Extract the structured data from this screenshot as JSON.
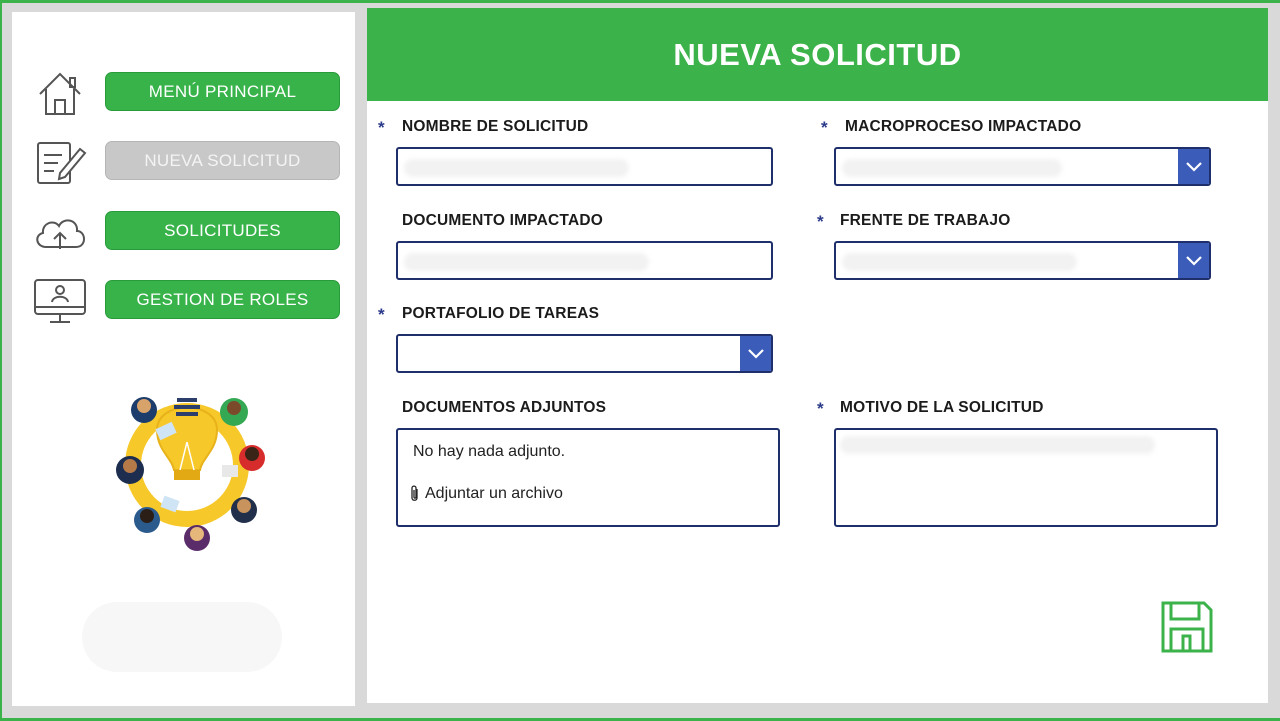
{
  "sidebar": {
    "items": [
      {
        "label": "MENÚ PRINCIPAL",
        "icon": "home-icon",
        "active": true
      },
      {
        "label": "NUEVA SOLICITUD",
        "icon": "edit-document-icon",
        "active": false
      },
      {
        "label": "SOLICITUDES",
        "icon": "cloud-upload-icon",
        "active": true
      },
      {
        "label": "GESTION DE ROLES",
        "icon": "user-monitor-icon",
        "active": true
      }
    ]
  },
  "header": {
    "title": "NUEVA SOLICITUD"
  },
  "form": {
    "required_mark": "*",
    "nombre": {
      "label": "NOMBRE DE SOLICITUD"
    },
    "macroproceso": {
      "label": "MACROPROCESO IMPACTADO"
    },
    "documento": {
      "label": "DOCUMENTO IMPACTADO"
    },
    "frente": {
      "label": "FRENTE DE TRABAJO"
    },
    "portafolio": {
      "label": "PORTAFOLIO DE TAREAS"
    },
    "adjuntos": {
      "label": "DOCUMENTOS ADJUNTOS",
      "empty_text": "No hay nada adjunto.",
      "attach_label": "Adjuntar un archivo"
    },
    "motivo": {
      "label": "MOTIVO DE LA SOLICITUD"
    }
  },
  "colors": {
    "brand_green": "#3cb24a",
    "field_border": "#1f2f6b",
    "dropdown_blue": "#3b5cb8"
  }
}
